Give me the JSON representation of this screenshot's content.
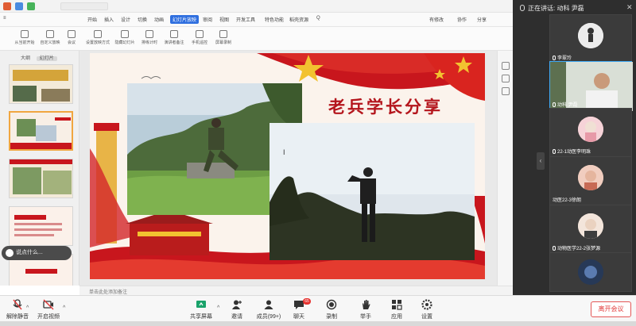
{
  "wps": {
    "menu": [
      "开始",
      "插入",
      "设计",
      "切换",
      "动画",
      "幻灯片放映",
      "审阅",
      "视图",
      "开发工具",
      "特色功能",
      "稻壳资源"
    ],
    "search_placeholder": "Q",
    "right_actions": [
      "有修改",
      "协作",
      "分享"
    ],
    "ribbon": [
      "从当前开始",
      "自定义放映",
      "会议",
      "设置放映方式",
      "隐藏幻灯片",
      "排练计时",
      "演讲者备注",
      "手机遥控",
      "屏幕录制"
    ],
    "thumb_tabs": [
      "大纲",
      "幻灯片"
    ],
    "status_text": "单击此处添加备注",
    "slide_title": "老兵学长分享",
    "cursor": "I"
  },
  "chat_bubble": {
    "text": "说点什么..."
  },
  "panel": {
    "speaking_label": "正在讲话: 动科 尹磊",
    "participants": [
      {
        "name": "李翠玲"
      },
      {
        "name": "动科 尹磊"
      },
      {
        "name": "22-1动医李明珠"
      },
      {
        "name": "动医22-3徐朗"
      },
      {
        "name": "动物医学22-2张梦源"
      },
      {
        "name": ""
      }
    ]
  },
  "toolbar": {
    "mute_label": "解除静音",
    "video_label": "开启视频",
    "share_label": "共享屏幕",
    "invite_label": "邀请",
    "members_label": "成员(99+)",
    "chat_label": "聊天",
    "chat_badge": "65",
    "record_label": "录制",
    "hand_label": "举手",
    "apps_label": "应用",
    "settings_label": "设置",
    "leave_label": "离开会议"
  },
  "colors": {
    "accent_blue": "#3fa9f5",
    "leave_red": "#e23b3b",
    "slide_red": "#c8161d",
    "slide_gold": "#f2c230"
  }
}
